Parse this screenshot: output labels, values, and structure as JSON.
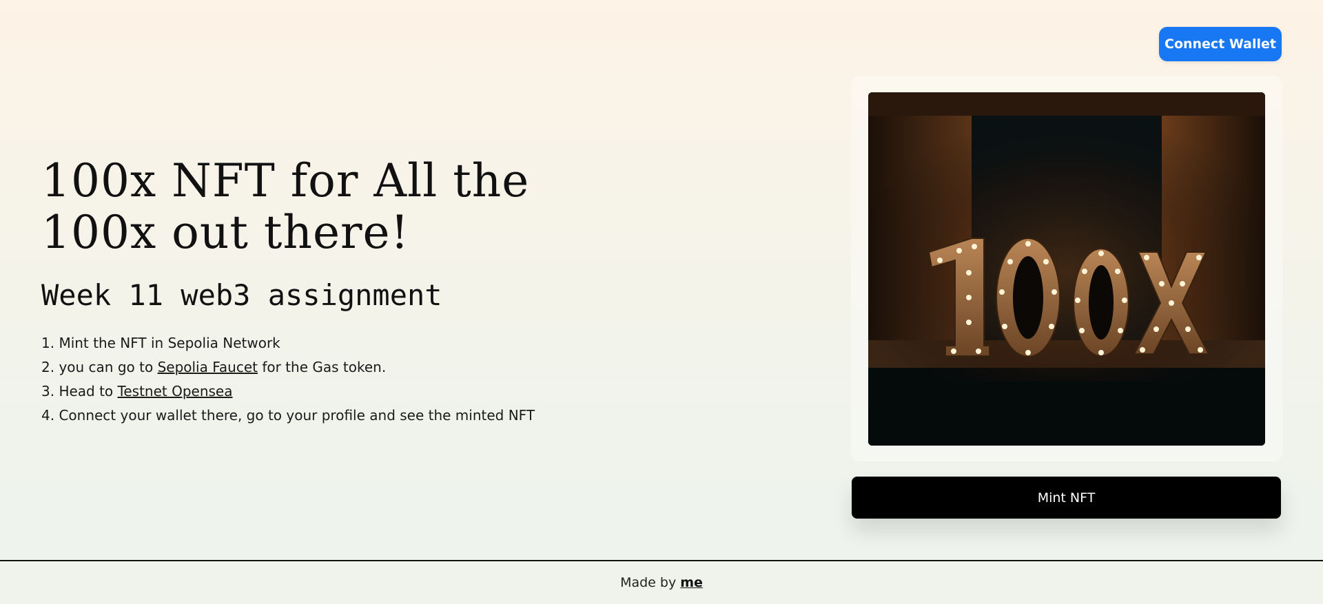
{
  "header": {
    "connect_wallet_label": "Connect Wallet"
  },
  "hero": {
    "title": "100x NFT for All the 100x out there!",
    "subtitle": "Week 11 web3 assignment",
    "steps": [
      {
        "prefix": "1. Mint the NFT in Sepolia Network",
        "link": "",
        "suffix": ""
      },
      {
        "prefix": "2. you can go to ",
        "link": "Sepolia Faucet",
        "suffix": " for the Gas token."
      },
      {
        "prefix": "3. Head to ",
        "link": "Testnet Opensea",
        "suffix": ""
      },
      {
        "prefix": "4. Connect your wallet there, go to your profile and see the minted NFT",
        "link": "",
        "suffix": ""
      }
    ]
  },
  "nft": {
    "image_text": "100X",
    "mint_label": "Mint NFT"
  },
  "footer": {
    "prefix": "Made by ",
    "link": "me"
  },
  "colors": {
    "connect_button": "#1877f2",
    "mint_button": "#000000"
  }
}
